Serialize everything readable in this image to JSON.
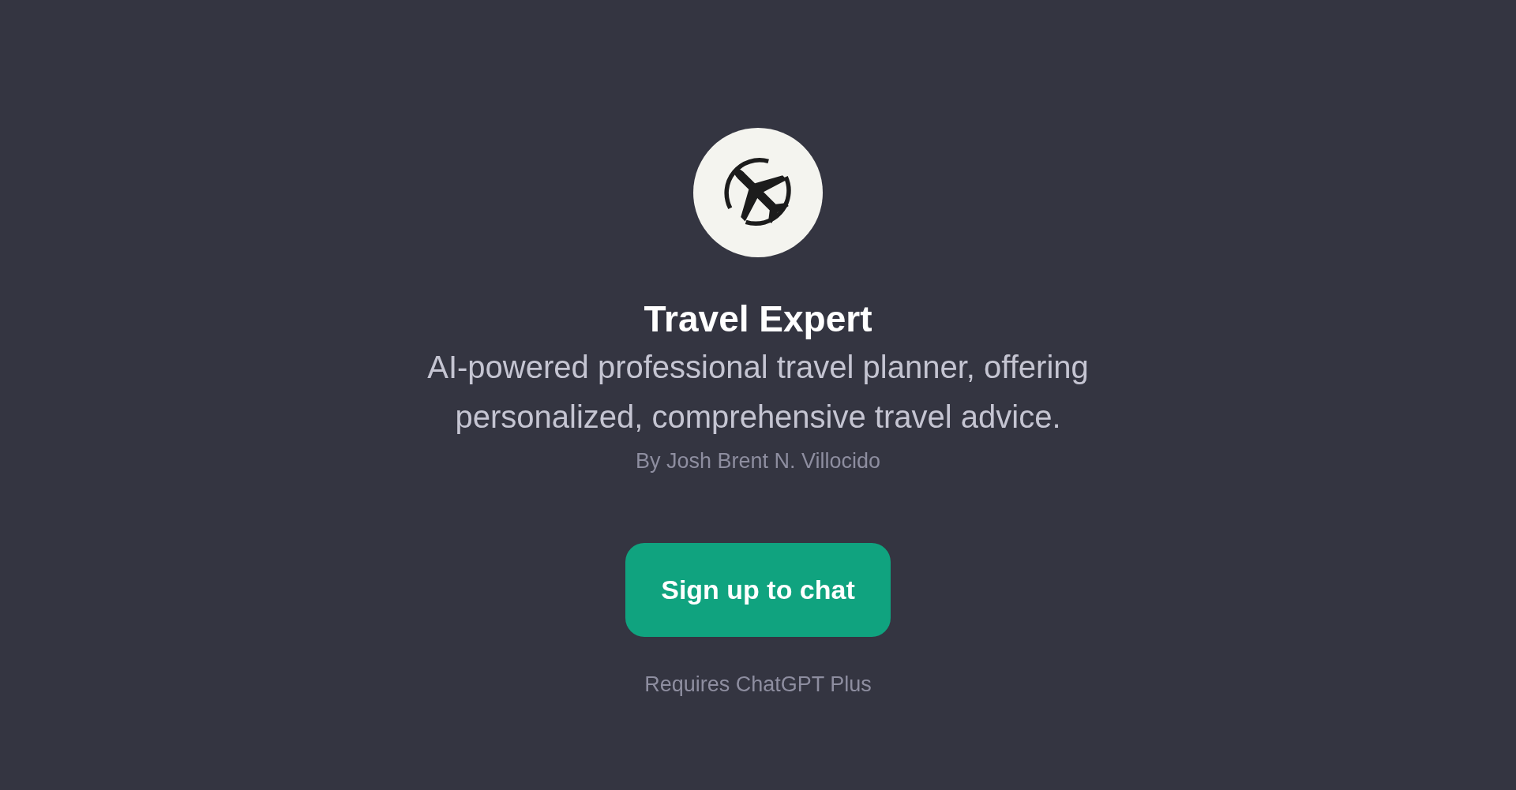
{
  "title": "Travel Expert",
  "description": "AI-powered professional travel planner, offering personalized, comprehensive travel advice.",
  "author": "By Josh Brent N. Villocido",
  "signup_button": "Sign up to chat",
  "requirement": "Requires ChatGPT Plus"
}
